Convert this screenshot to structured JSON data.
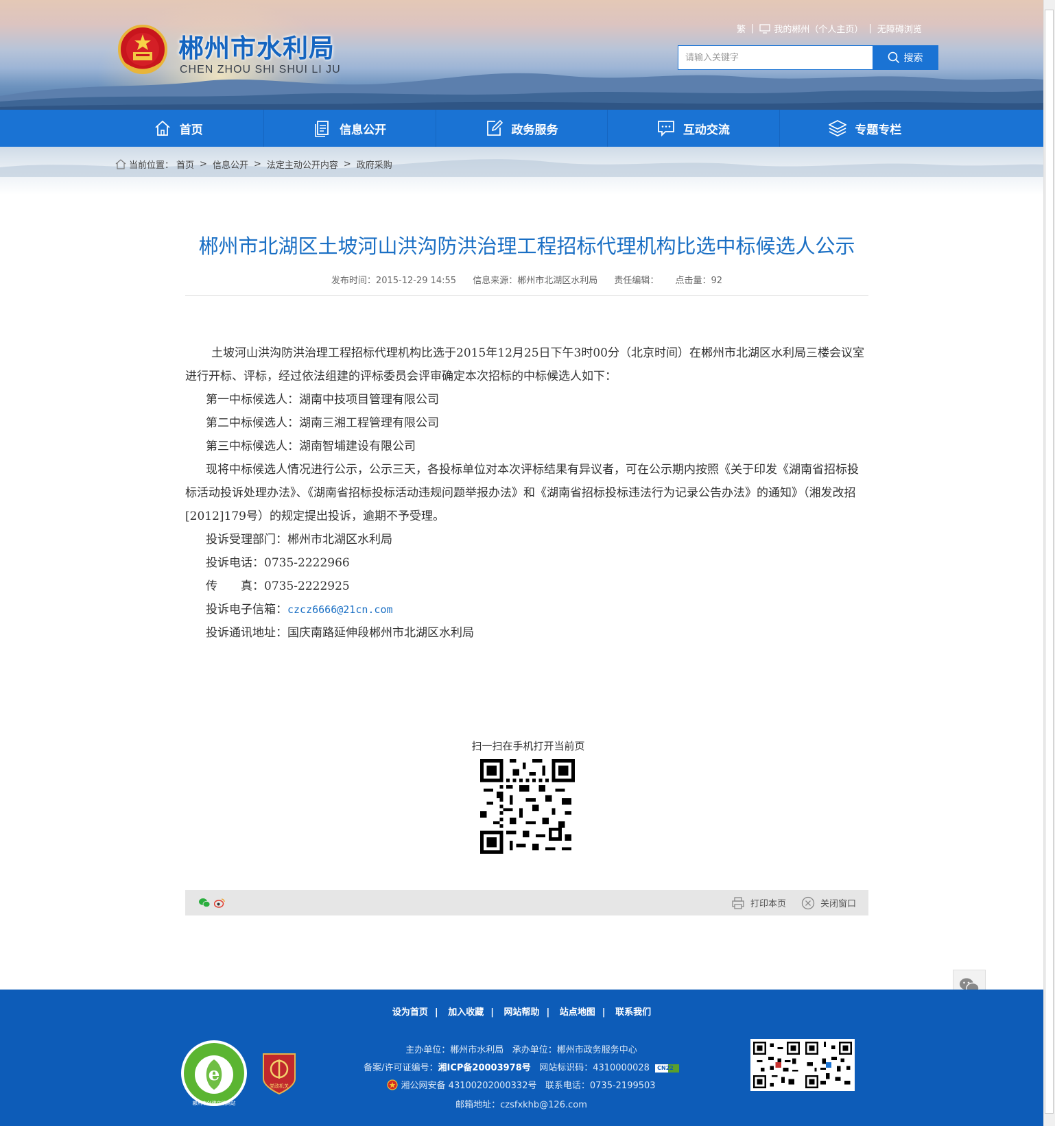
{
  "header": {
    "title": "郴州市水利局",
    "subtitle": "CHEN ZHOU SHI SHUI LI JU",
    "top_links": {
      "traditional": "繁",
      "my_chenzhou": "我的郴州（个人主页）",
      "accessible": "无障碍浏览"
    },
    "search": {
      "placeholder": "请输入关键字",
      "button_label": "搜索"
    }
  },
  "nav": {
    "items": [
      {
        "label": "首页",
        "icon": "home-icon"
      },
      {
        "label": "信息公开",
        "icon": "document-icon"
      },
      {
        "label": "政务服务",
        "icon": "edit-icon"
      },
      {
        "label": "互动交流",
        "icon": "chat-icon"
      },
      {
        "label": "专题专栏",
        "icon": "layers-icon"
      }
    ]
  },
  "breadcrumb": {
    "prefix": "当前位置：",
    "items": [
      "首页",
      "信息公开",
      "法定主动公开内容",
      "政府采购"
    ]
  },
  "article": {
    "title": "郴州市北湖区土坡河山洪沟防洪治理工程招标代理机构比选中标候选人公示",
    "meta": {
      "publish_time": "发布时间：2015-12-29 14:55",
      "source": "信息来源：郴州市北湖区水利局",
      "editor": "责任编辑：",
      "views": "点击量：92"
    },
    "paragraphs": [
      "土坡河山洪沟防洪治理工程招标代理机构比选于2015年12月25日下午3时00分（北京时间）在郴州市北湖区水利局三楼会议室进行开标、评标，经过依法组建的评标委员会评审确定本次招标的中标候选人如下：",
      "第一中标候选人：湖南中技项目管理有限公司",
      "第二中标候选人：湖南三湘工程管理有限公司",
      "第三中标候选人：湖南智埔建设有限公司",
      "现将中标候选人情况进行公示，公示三天，各投标单位对本次评标结果有异议者，可在公示期内按照《关于印发《湖南省招标投标活动投诉处理办法》、《湖南省招标投标活动违规问题举报办法》和《湖南省招标投标违法行为记录公告办法》的通知》（湘发改招[2012]179号）的规定提出投诉，逾期不予受理。",
      "投诉受理部门：郴州市北湖区水利局",
      "投诉电话：0735-2222966",
      "传　　真：0735-2222925"
    ],
    "email_label": "投诉电子信箱：",
    "email": "czcz6666@21cn.com",
    "address": "投诉通讯地址：国庆南路延伸段郴州市北湖区水利局"
  },
  "qr": {
    "label": "扫一扫在手机打开当前页"
  },
  "toolbar": {
    "print": "打印本页",
    "close": "关闭窗口"
  },
  "footer": {
    "links": [
      "设为首页",
      "加入收藏",
      "网站帮助",
      "站点地图",
      "联系我们"
    ],
    "sponsor": "主办单位：郴州市水利局",
    "organizer": "承办单位：郴州市政务服务中心",
    "icp_label": "备案/许可证编号：",
    "icp": "湘ICP备20003978号",
    "site_code": "网站标识码：4310000028",
    "police": "湘公网安备 43100202000332号",
    "phone": "联系电话：0735-2199503",
    "email": "邮箱地址：czsfxkhb@126.com",
    "badge_text": "郴州市创建文明网站",
    "party_badge": "党政机关",
    "cn_badge": "CN22"
  },
  "colors": {
    "brand_blue": "#1a73d4",
    "footer_blue": "#0d5cb8",
    "title_blue": "#1a6fc4"
  }
}
